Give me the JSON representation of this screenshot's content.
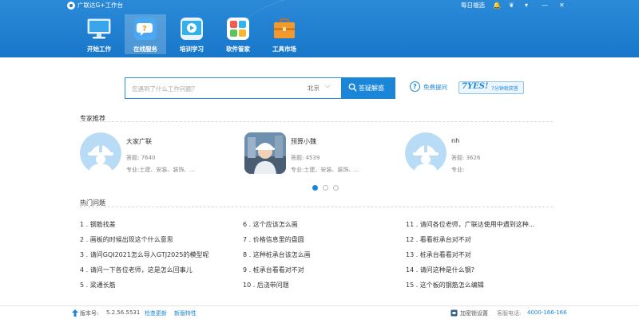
{
  "app": {
    "title": "广联达G+工作台",
    "daily": "每日福选"
  },
  "nav": [
    {
      "label": "开始工作"
    },
    {
      "label": "在线服务"
    },
    {
      "label": "培训学习"
    },
    {
      "label": "软件管家"
    },
    {
      "label": "工具市场"
    }
  ],
  "search": {
    "placeholder": "您遇到了什么工作问题?",
    "city": "北京",
    "button": "答疑解惑",
    "free_question": "免费提问",
    "yes_badge_big": "7YES!",
    "yes_badge_small": "7分钟就获答"
  },
  "experts_section": {
    "title": "专家推荐",
    "experts": [
      {
        "name": "大家广联",
        "answers_label": "答题:",
        "answers": "7640",
        "major": "专业:土建、安装、装饰、..."
      },
      {
        "name": "预算小魏",
        "answers_label": "答题:",
        "answers": "4539",
        "major": "专业:土建、安装、装饰、..."
      },
      {
        "name": "nh",
        "answers_label": "答题:",
        "answers": "3626",
        "major": "专业:"
      }
    ],
    "carousel_active": 1,
    "carousel_total": 3
  },
  "hot_section": {
    "title": "热门问题",
    "questions": [
      "1 . 钢筋找差",
      "2 . 画板的时候出现这个什么意思",
      "3 . 请问GQI2021怎么导入GTJ2025的模型呢",
      "4 . 请问一下各位老师，这是怎么回事儿",
      "5 . 梁通长筋",
      "6 . 这个应该怎么画",
      "7 . 价格信息里的盘圆",
      "8 . 这种桩承台该怎么画",
      "9 . 桩承台看看对不对",
      "10 . 后浇带问题",
      "11 . 请问各位老师，广联达使用中遇到这种...",
      "12 . 看看桩承台对不对",
      "13 . 桩承台看看对不对",
      "14 . 请问这种是什么钢?",
      "15 . 这个板的钢筋怎么编辑"
    ]
  },
  "footer": {
    "version_label": "版本号:",
    "version": "5.2.56.5531",
    "check_update": "检查更新",
    "new_features": "新版特性",
    "lock_settings": "加密锁设置",
    "hotline_label": "客服电话:",
    "hotline": "4000-166-166"
  },
  "colors": {
    "header": "#1877c9",
    "accent": "#1b86d8"
  }
}
